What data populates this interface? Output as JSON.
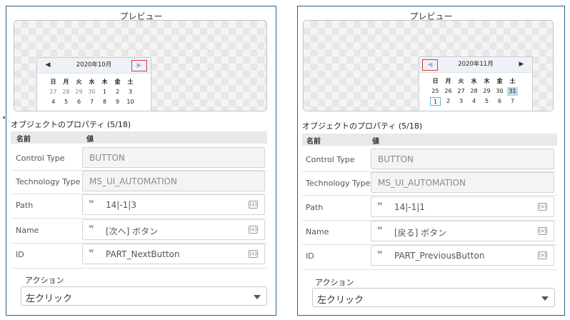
{
  "panels": [
    {
      "preview_title": "プレビュー",
      "calendar": {
        "prev_icon": "triangle-left-icon",
        "next_icon": "triangle-right-icon",
        "month": "2020年10月",
        "weekdays": [
          "日",
          "月",
          "火",
          "水",
          "木",
          "金",
          "土"
        ],
        "days": [
          "27",
          "28",
          "29",
          "30",
          "1",
          "2",
          "3",
          "4",
          "5",
          "6",
          "7",
          "8",
          "9",
          "10"
        ]
      },
      "props_title": "オブジェクトのプロパティ (5/18)",
      "header": {
        "name": "名前",
        "value": "値"
      },
      "rows": [
        {
          "label": "Control Type",
          "value": "BUTTON"
        },
        {
          "label": "Technology Type",
          "value": "MS_UI_AUTOMATION"
        },
        {
          "label": "Path",
          "value": "14|-1|3"
        },
        {
          "label": "Name",
          "value": "[次へ] ボタン"
        },
        {
          "label": "ID",
          "value": "PART_NextButton"
        }
      ],
      "quote_icon": "quote-icon",
      "var_icon_text": "{x}",
      "action_title": "アクション",
      "action_value": "左クリック"
    },
    {
      "preview_title": "プレビュー",
      "calendar": {
        "prev_icon": "triangle-left-icon",
        "next_icon": "triangle-right-icon",
        "month": "2020年11月",
        "weekdays": [
          "日",
          "月",
          "火",
          "水",
          "木",
          "金",
          "土"
        ],
        "days": [
          "25",
          "26",
          "27",
          "28",
          "29",
          "30",
          "31",
          "1",
          "2",
          "3",
          "4",
          "5",
          "6",
          "7"
        ]
      },
      "props_title": "オブジェクトのプロパティ (5/18)",
      "header": {
        "name": "名前",
        "value": "値"
      },
      "rows": [
        {
          "label": "Control Type",
          "value": "BUTTON"
        },
        {
          "label": "Technology Type",
          "value": "MS_UI_AUTOMATION"
        },
        {
          "label": "Path",
          "value": "14|-1|1"
        },
        {
          "label": "Name",
          "value": "[戻る] ボタン"
        },
        {
          "label": "ID",
          "value": "PART_PreviousButton"
        }
      ],
      "quote_icon": "quote-icon",
      "var_icon_text": "{x}",
      "action_title": "アクション",
      "action_value": "左クリック"
    }
  ],
  "colors": {
    "highlight": "#e03a3a",
    "panel_border": "#2f5d86",
    "selected_day": "#bcd7e3",
    "today_border": "#5fb8d5"
  }
}
